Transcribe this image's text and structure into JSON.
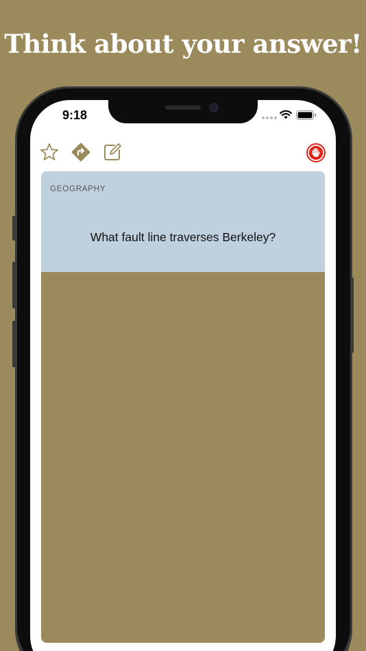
{
  "headline": "Think about your answer!",
  "status_bar": {
    "time": "9:18",
    "wifi_icon": "wifi-icon",
    "battery_icon": "battery-icon"
  },
  "toolbar": {
    "favorite_icon": "star-icon",
    "share_icon": "share-arrow-icon",
    "edit_icon": "edit-icon",
    "stop_icon": "stop-hand-icon"
  },
  "card": {
    "category": "GEOGRAPHY",
    "question": "What fault line traverses Berkeley?"
  },
  "colors": {
    "background": "#9b8a5c",
    "card_top": "#bfd1de",
    "accent": "#9b8a5c",
    "stop_red": "#e0261b"
  }
}
